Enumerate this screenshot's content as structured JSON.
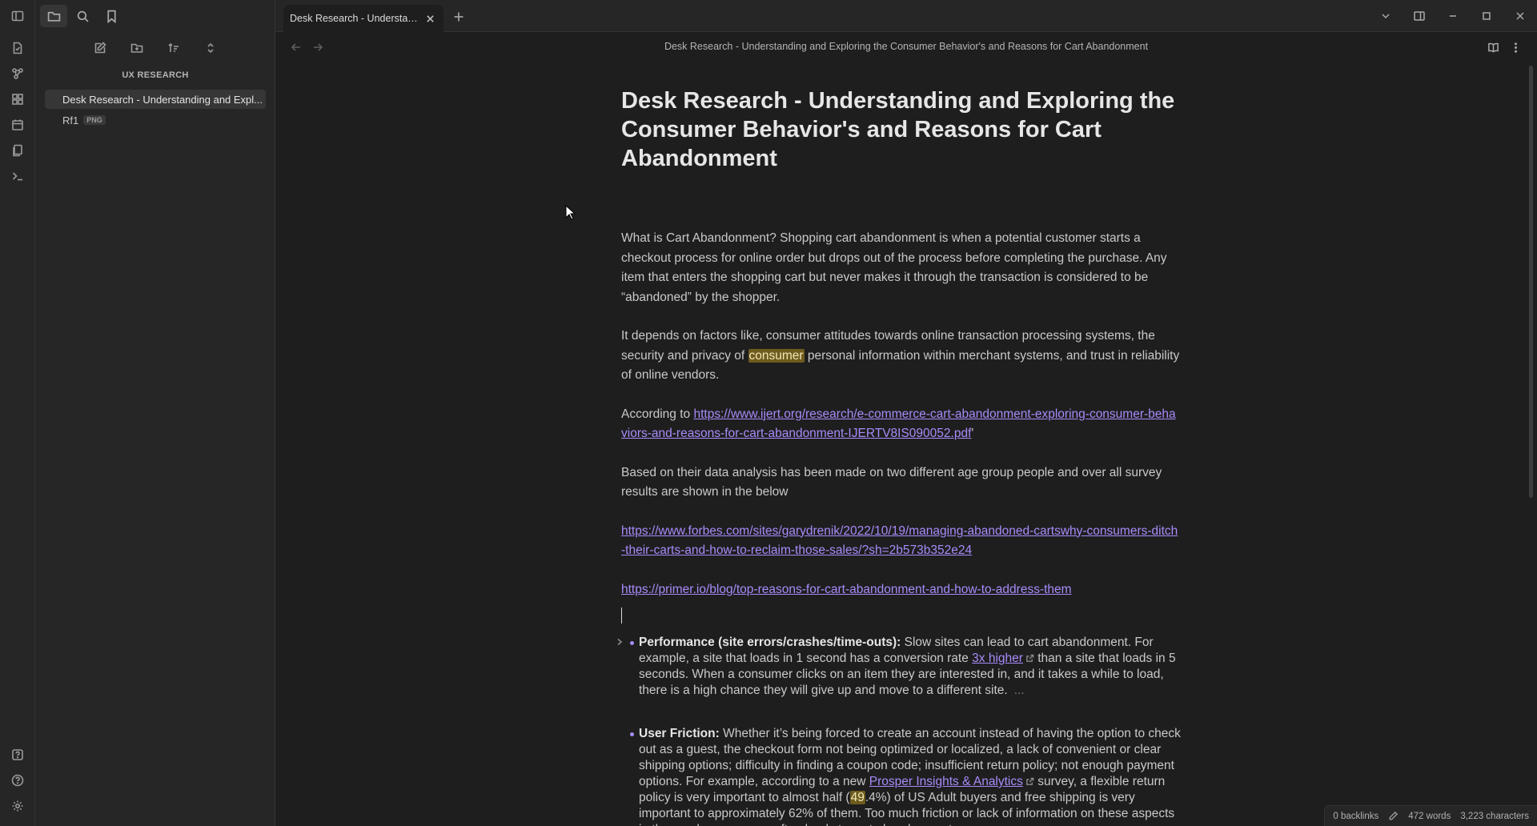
{
  "tab": {
    "title": "Desk Research - Understanding and Exploring the Consumer Behavior's and Reasons for Cart Abandonment"
  },
  "sidebar": {
    "vault_name": "UX RESEARCH",
    "files": [
      {
        "label": "Desk Research - Understanding and Expl...",
        "active": true
      },
      {
        "label": "Rf1",
        "badge": "PNG"
      }
    ]
  },
  "view": {
    "header_title": "Desk Research - Understanding and Exploring the Consumer Behavior's and Reasons for Cart Abandonment"
  },
  "doc": {
    "title": "Desk Research - Understanding and Exploring the Consumer Behavior's and Reasons for Cart Abandonment",
    "p1": "What is Cart Abandonment? Shopping cart abandonment is when a potential customer starts a checkout process for online order but drops out of the process before completing the purchase. Any item that enters the shopping cart but never makes it through the transaction is considered to be “abandoned” by the shopper.",
    "p2_before": "It depends on factors like, consumer attitudes towards online transaction processing systems, the security and privacy of ",
    "p2_highlight": "consumer",
    "p2_after": " personal information within merchant systems, and trust in reliability of online vendors.",
    "p3_prefix": "According to ",
    "p3_link": "https://www.ijert.org/research/e-commerce-cart-abandonment-exploring-consumer-behaviors-and-reasons-for-cart-abandonment-IJERTV8IS090052.pdf",
    "p3_suffix": "'",
    "p4": "Based on their data analysis has been made on two different age group people and over all survey results are shown in the below",
    "link_forbes": "https://www.forbes.com/sites/garydrenik/2022/10/19/managing-abandoned-cartswhy-consumers-ditch-their-carts-and-how-to-reclaim-those-sales/?sh=2b573b352e24",
    "link_primer": "https://primer.io/blog/top-reasons-for-cart-abandonment-and-how-to-address-them",
    "b1_title": "Performance (site errors/crashes/time-outs):",
    "b1_text_a": " Slow sites can lead to cart abandonment. For example, a site that loads in 1 second has a conversion rate ",
    "b1_link": "3x higher",
    "b1_text_b": " than a site that loads in 5 seconds. When a consumer clicks on an item they are interested in, and it takes a while to load, there is a high chance they will give up and move to a different site.",
    "b1_more": "...",
    "b2_title": "User Friction:",
    "b2_text_a": " Whether it’s being forced to create an account instead of having the option to check out as a guest, the checkout form not being optimized or localized, a lack of convenient or clear shipping options; difficulty in finding a coupon code; insufficient return policy; not enough payment options. For example, according to a new ",
    "b2_link": "Prosper Insights & Analytics",
    "b2_text_b": " survey, a flexible return policy is very important to almost half (",
    "b2_highlight": "49",
    "b2_text_c": ".4%) of US Adult buyers and free shipping is very important to approximately 62% of them. Too much friction or lack of information on these aspects in the purchase process often leads to cart abandonment."
  },
  "status": {
    "backlinks": "0 backlinks",
    "words": "472 words",
    "characters": "3,223 characters"
  }
}
